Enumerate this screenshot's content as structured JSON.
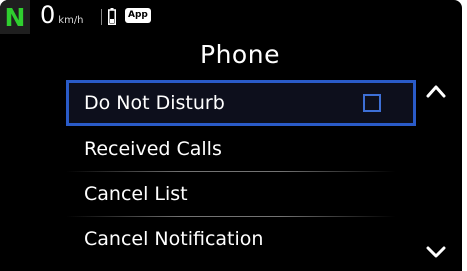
{
  "status_bar": {
    "gear": "N",
    "speed_value": "0",
    "speed_unit": "km/h",
    "battery_icon": "battery-icon",
    "app_badge": "App"
  },
  "title": "Phone",
  "menu": {
    "items": [
      {
        "label": "Do Not Disturb",
        "selected": true,
        "checkbox": true,
        "checked": false
      },
      {
        "label": "Received Calls"
      },
      {
        "label": "Cancel List"
      },
      {
        "label": "Cancel Notification"
      }
    ],
    "scroll_up_icon": "chevron-up-icon",
    "scroll_down_icon": "chevron-down-icon"
  },
  "colors": {
    "gear": "#2fcf2f",
    "selection_border": "#2a5bc8",
    "checkbox_border": "#3d6fd6",
    "background": "#000000"
  }
}
